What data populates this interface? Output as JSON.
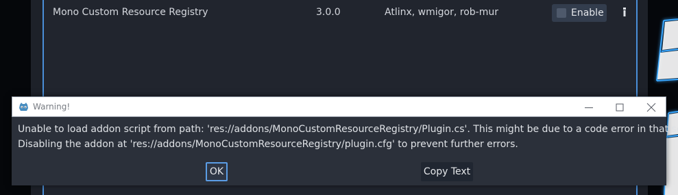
{
  "plugin_row": {
    "name": "Mono Custom Resource Registry",
    "version": "3.0.0",
    "author": "Atlinx, wmigor, rob-mur",
    "enable_label": "Enable",
    "enabled": false
  },
  "dialog": {
    "title": "Warning!",
    "message_line1": "Unable to load addon script from path: 'res://addons/MonoCustomResourceRegistry/Plugin.cs'. This might be due to a code error in that script.",
    "message_line2": "Disabling the addon at 'res://addons/MonoCustomResourceRegistry/plugin.cfg' to prevent further errors.",
    "ok_label": "OK",
    "copy_label": "Copy Text"
  },
  "colors": {
    "accent": "#4a8fd9",
    "dialog_bg": "#2b303a",
    "neon": "#3aa8ff"
  }
}
